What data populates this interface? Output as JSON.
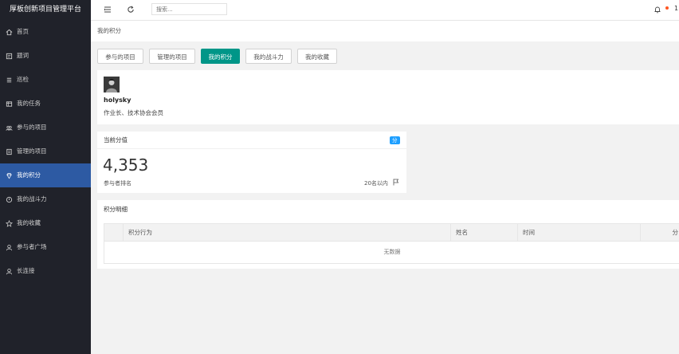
{
  "app": {
    "title": "厚板创新项目管理平台"
  },
  "sidebar": {
    "items": [
      {
        "label": "首页",
        "icon": "home-icon"
      },
      {
        "label": "题词",
        "icon": "note-icon"
      },
      {
        "label": "巡检",
        "icon": "list-icon"
      },
      {
        "label": "我的任务",
        "icon": "task-icon"
      },
      {
        "label": "参与的项目",
        "icon": "people-icon"
      },
      {
        "label": "管理的项目",
        "icon": "manage-icon"
      },
      {
        "label": "我的积分",
        "icon": "diamond-icon",
        "active": true
      },
      {
        "label": "我的战斗力",
        "icon": "power-icon"
      },
      {
        "label": "我的收藏",
        "icon": "star-icon"
      },
      {
        "label": "参与者广场",
        "icon": "user-icon"
      },
      {
        "label": "长连接",
        "icon": "user-link-icon"
      }
    ]
  },
  "topbar": {
    "search_placeholder": "搜索...",
    "user_initial": "1"
  },
  "breadcrumb": "我的积分",
  "tabs": [
    {
      "label": "参与的项目"
    },
    {
      "label": "管理的项目"
    },
    {
      "label": "我的积分",
      "active": true
    },
    {
      "label": "我的战斗力"
    },
    {
      "label": "我的收藏"
    }
  ],
  "profile": {
    "name": "holysky",
    "title": "作业长、技术协会会员"
  },
  "score": {
    "header": "当前分值",
    "badge": "分",
    "value": "4,353",
    "label": "参与者排名",
    "rank": "20名以内"
  },
  "detail": {
    "header": "积分明细",
    "columns": [
      "积分行为",
      "姓名",
      "时间",
      "分"
    ],
    "empty_text": "无数据"
  },
  "colors": {
    "sidebar_bg": "#20222a",
    "active_nav": "#2d5aa3",
    "active_tab": "#009688",
    "badge": "#1e9fff",
    "notify_dot": "#ff5722"
  }
}
